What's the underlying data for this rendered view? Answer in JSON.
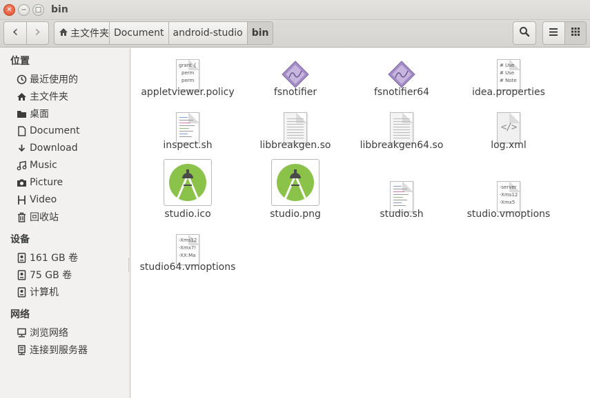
{
  "window": {
    "title": "bin"
  },
  "toolbar": {
    "home_label": "主文件夹",
    "crumbs": [
      "Document",
      "android-studio",
      "bin"
    ]
  },
  "sidebar": {
    "places_header": "位置",
    "places": [
      {
        "label": "最近使用的",
        "icon": "clock-icon"
      },
      {
        "label": "主文件夹",
        "icon": "home-icon"
      },
      {
        "label": "桌面",
        "icon": "folder-icon"
      },
      {
        "label": "Document",
        "icon": "document-icon"
      },
      {
        "label": "Download",
        "icon": "download-icon"
      },
      {
        "label": "Music",
        "icon": "music-icon"
      },
      {
        "label": "Picture",
        "icon": "camera-icon"
      },
      {
        "label": "Video",
        "icon": "film-icon"
      },
      {
        "label": "回收站",
        "icon": "trash-icon"
      }
    ],
    "devices_header": "设备",
    "devices": [
      {
        "label": "161 GB 卷",
        "icon": "drive-icon"
      },
      {
        "label": "75 GB 卷",
        "icon": "drive-icon"
      },
      {
        "label": "计算机",
        "icon": "drive-icon"
      }
    ],
    "network_header": "网络",
    "network": [
      {
        "label": "浏览网络",
        "icon": "network-icon"
      },
      {
        "label": "连接到服务器",
        "icon": "server-icon"
      }
    ]
  },
  "files": [
    {
      "name": "appletviewer.policy",
      "type": "text",
      "preview": [
        "grant {",
        "perm",
        "perm"
      ]
    },
    {
      "name": "fsnotifier",
      "type": "executable"
    },
    {
      "name": "fsnotifier64",
      "type": "executable"
    },
    {
      "name": "idea.properties",
      "type": "text",
      "preview": [
        "# Use",
        "# Use",
        "# Note"
      ]
    },
    {
      "name": "inspect.sh",
      "type": "script"
    },
    {
      "name": "libbreakgen.so",
      "type": "library"
    },
    {
      "name": "libbreakgen64.so",
      "type": "library"
    },
    {
      "name": "log.xml",
      "type": "xml"
    },
    {
      "name": "studio.ico",
      "type": "android-image"
    },
    {
      "name": "studio.png",
      "type": "android-image"
    },
    {
      "name": "studio.sh",
      "type": "script"
    },
    {
      "name": "studio.vmoptions",
      "type": "text",
      "preview": [
        "-server",
        "-Xms12",
        "-Xmx5"
      ]
    },
    {
      "name": "studio64.vmoptions",
      "type": "text",
      "preview": [
        "-Xms12",
        "-Xmx7!",
        "-XX:Ma"
      ]
    }
  ],
  "colors": {
    "close_button": "#e3522f",
    "android_green": "#8bc34a",
    "executable_purple": "#a58cc6"
  }
}
